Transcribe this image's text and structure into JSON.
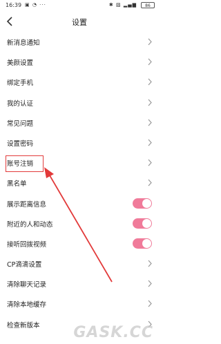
{
  "status_bar": {
    "time": "16:39",
    "left_icons": "▣ ◔ ···",
    "right_icons": "✱ ▨ ▂▄▆",
    "battery": "86"
  },
  "nav": {
    "title": "设置",
    "back_icon": "chevron-left-icon"
  },
  "settings": {
    "items": [
      {
        "label": "新消息通知",
        "kind": "arrow"
      },
      {
        "label": "美颜设置",
        "kind": "arrow"
      },
      {
        "label": "绑定手机",
        "kind": "arrow"
      },
      {
        "label": "我的认证",
        "kind": "arrow"
      },
      {
        "label": "常见问题",
        "kind": "arrow"
      },
      {
        "label": "设置密码",
        "kind": "arrow"
      },
      {
        "label": "账号注销",
        "kind": "arrow"
      },
      {
        "label": "黑名单",
        "kind": "arrow"
      },
      {
        "label": "展示距离信息",
        "kind": "toggle",
        "on": true
      },
      {
        "label": "附近的人和动态",
        "kind": "toggle",
        "on": true
      },
      {
        "label": "接听回拨视频",
        "kind": "toggle",
        "on": true
      },
      {
        "label": "CP滴滴设置",
        "kind": "arrow"
      },
      {
        "label": "清除聊天记录",
        "kind": "arrow"
      },
      {
        "label": "清除本地缓存",
        "kind": "arrow"
      },
      {
        "label": "检查新版本",
        "kind": "arrow"
      }
    ]
  },
  "colors": {
    "toggle_on": "#f07b9a",
    "annotation": "#e23a3a"
  },
  "watermark": "GASK.CC"
}
